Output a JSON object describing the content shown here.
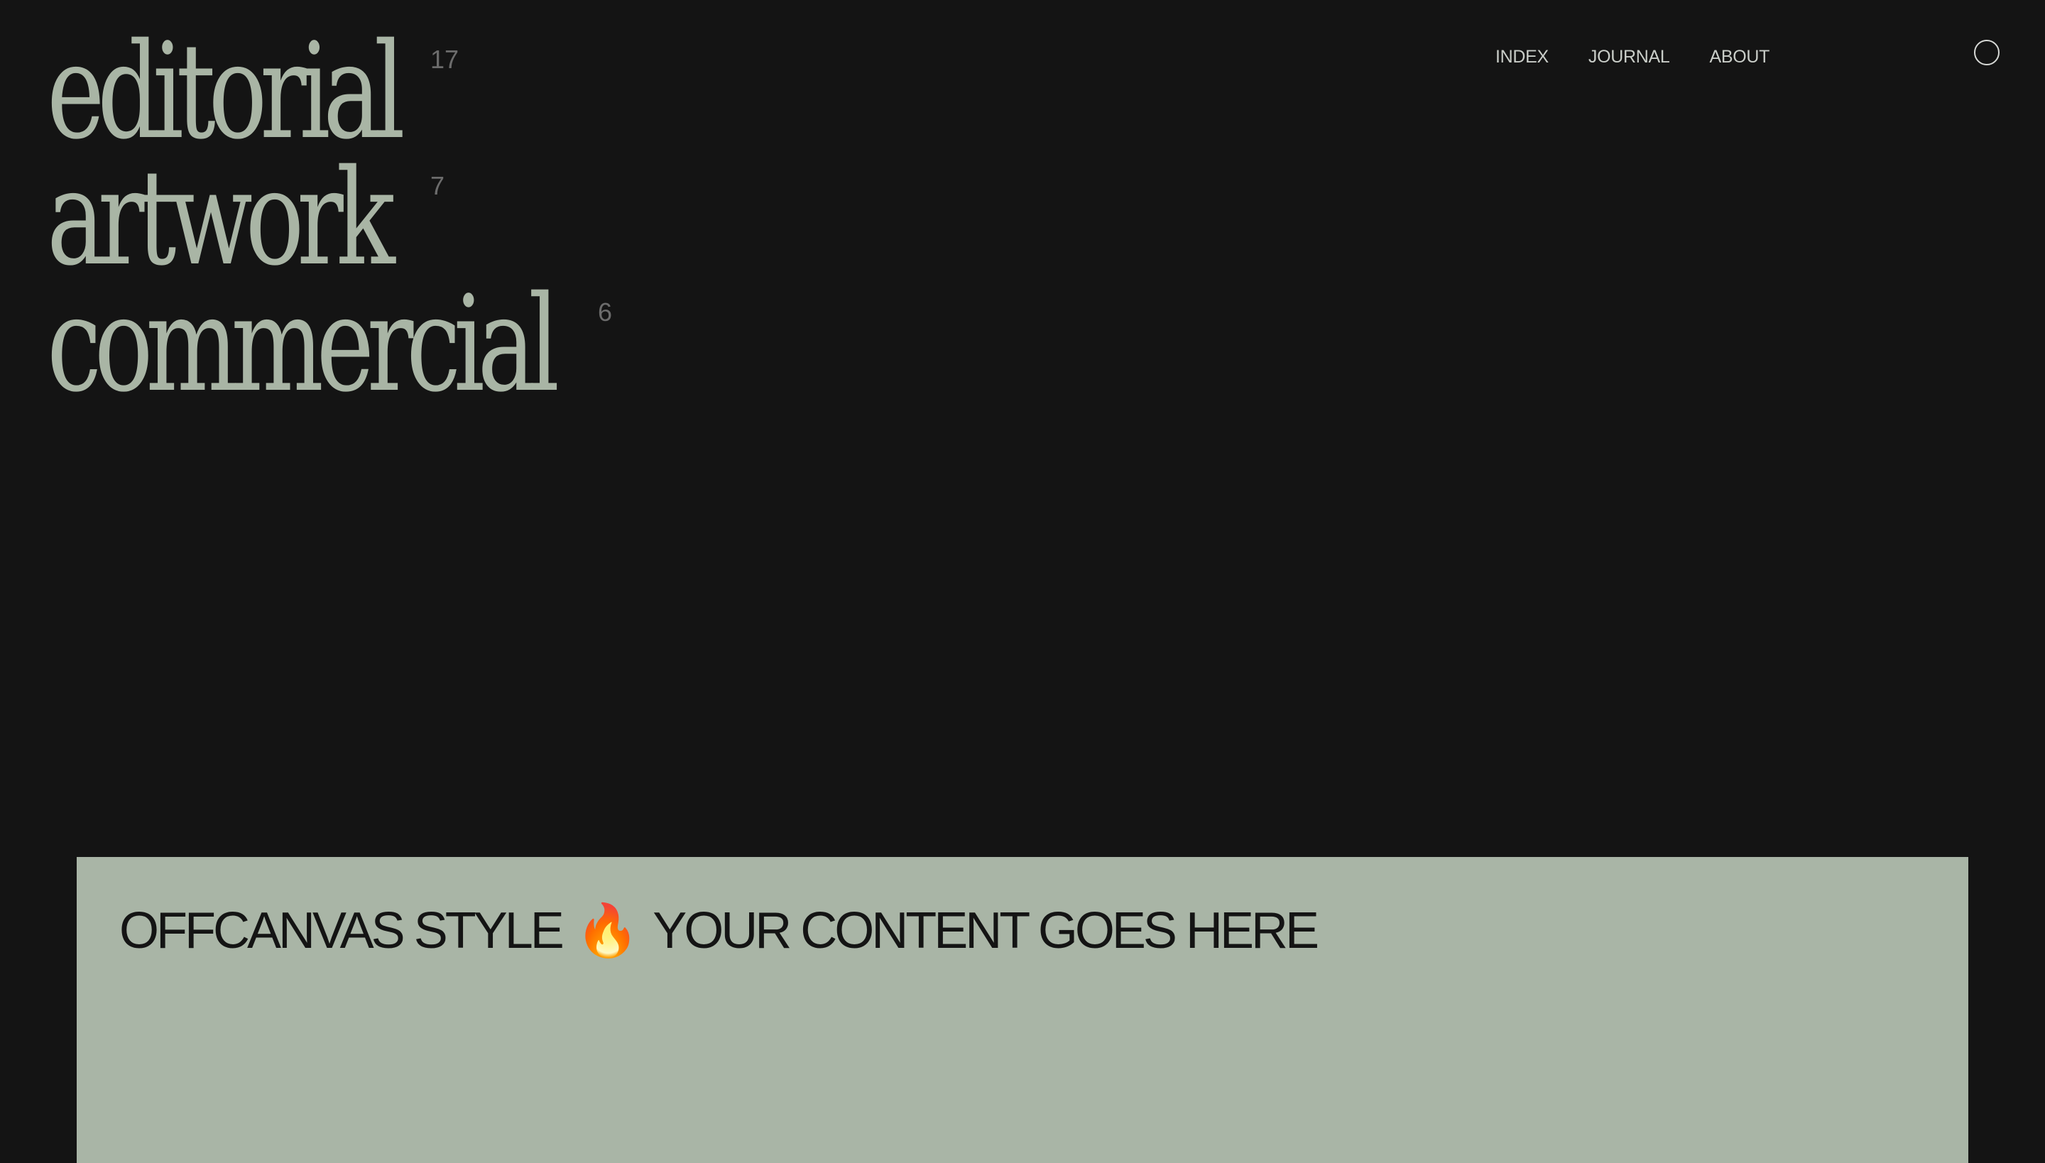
{
  "categories": [
    {
      "label": "editorial",
      "count": "17"
    },
    {
      "label": "artwork",
      "count": "7"
    },
    {
      "label": "commercial",
      "count": "6"
    }
  ],
  "nav": {
    "items": [
      {
        "label": "INDEX"
      },
      {
        "label": "JOURNAL"
      },
      {
        "label": "ABOUT"
      }
    ]
  },
  "offcanvas": {
    "text_before": "OFFCANVAS STYLE",
    "emoji": "🔥",
    "text_after": "YOUR CONTENT GOES HERE"
  },
  "colors": {
    "background": "#141414",
    "accent_sage": "#a9b5a5",
    "nav_text": "#c9cdc8",
    "count_text": "#6c6c6c"
  },
  "icons": {
    "menu_toggle": "circle-icon"
  }
}
